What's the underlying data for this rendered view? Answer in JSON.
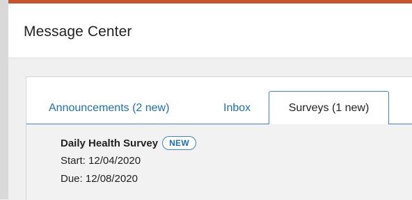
{
  "header": {
    "title": "Message Center"
  },
  "tabs": [
    {
      "label": "Announcements (2 new)",
      "active": false
    },
    {
      "label": "Inbox",
      "active": false
    },
    {
      "label": "Surveys (1 new)",
      "active": true
    }
  ],
  "surveys": [
    {
      "title": "Daily Health Survey",
      "badge": "NEW",
      "start": "Start: 12/04/2020",
      "due": "Due: 12/08/2020"
    }
  ],
  "colors": {
    "accent": "#c8522a",
    "link": "#1b6fb8",
    "tab_border": "#3b86c8"
  }
}
